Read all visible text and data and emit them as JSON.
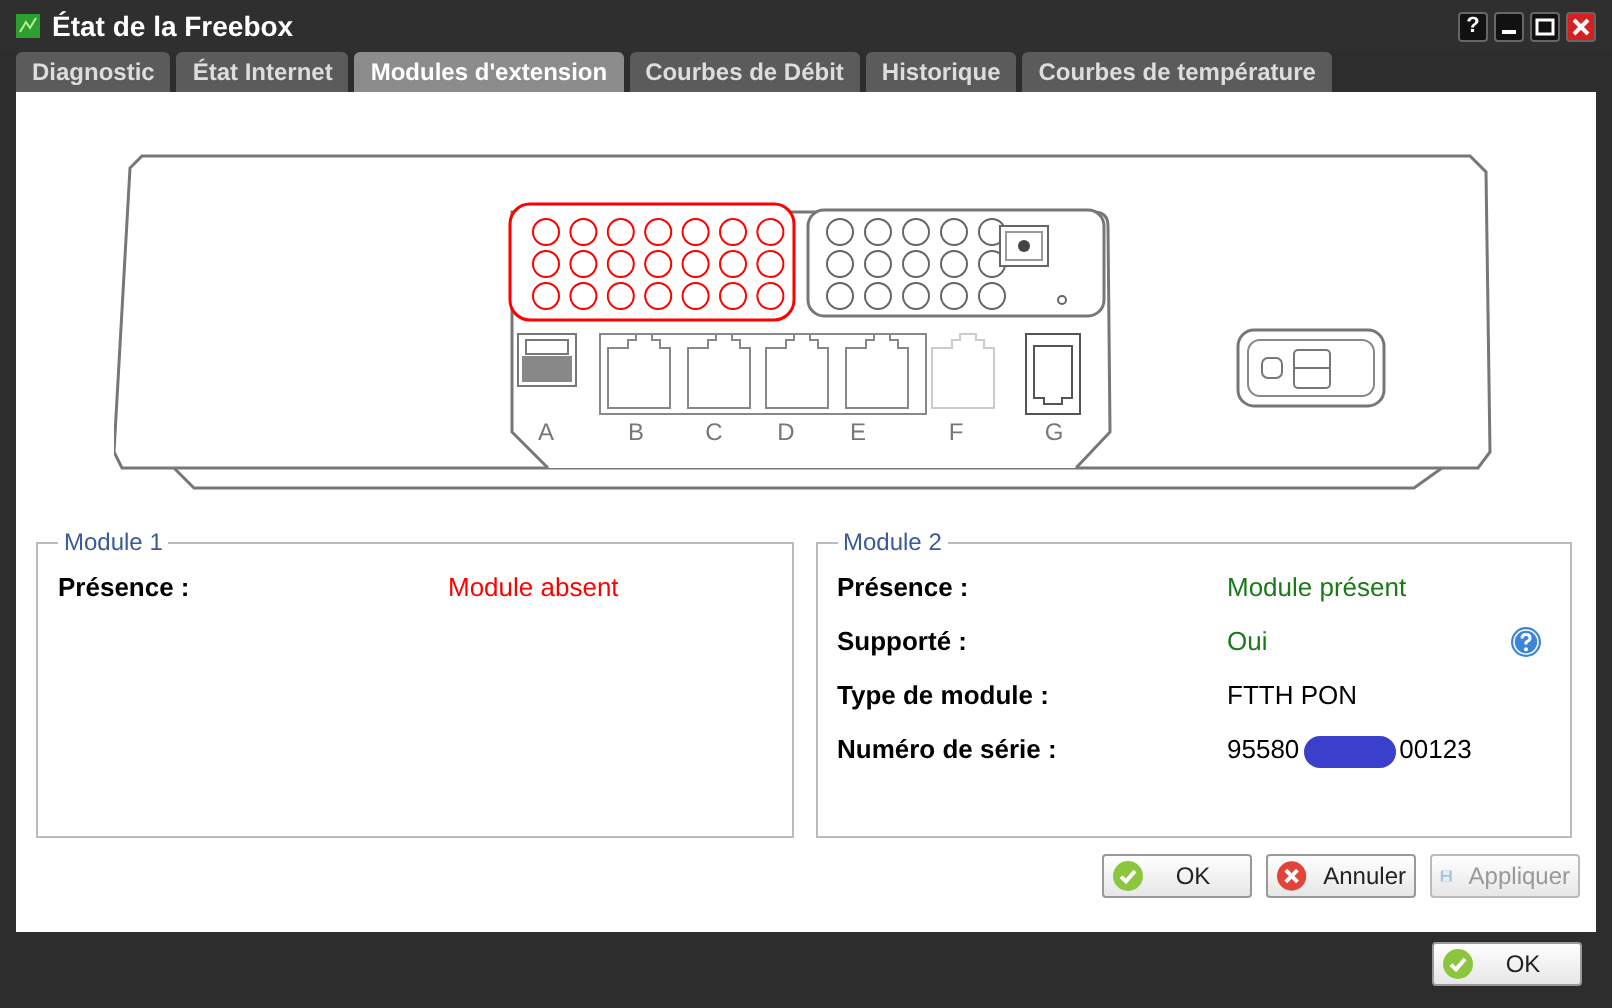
{
  "window": {
    "title": "État de la Freebox",
    "help_button": "?"
  },
  "tabs": [
    {
      "label": "Diagnostic",
      "selected": false
    },
    {
      "label": "État Internet",
      "selected": false
    },
    {
      "label": "Modules d'extension",
      "selected": true
    },
    {
      "label": "Courbes de Débit",
      "selected": false
    },
    {
      "label": "Historique",
      "selected": false
    },
    {
      "label": "Courbes de température",
      "selected": false
    }
  ],
  "device": {
    "ports": [
      {
        "label": "A",
        "kind": "usb"
      },
      {
        "label": "B",
        "kind": "ethernet"
      },
      {
        "label": "C",
        "kind": "ethernet"
      },
      {
        "label": "D",
        "kind": "ethernet"
      },
      {
        "label": "E",
        "kind": "ethernet"
      },
      {
        "label": "F",
        "kind": "ethernet_faint"
      },
      {
        "label": "G",
        "kind": "phone"
      }
    ]
  },
  "modules": [
    {
      "title": "Module 1",
      "highlighted": true,
      "rows": [
        {
          "label": "Présence :",
          "value": [
            "Module absent"
          ],
          "color": "#ff0000",
          "help": false
        }
      ]
    },
    {
      "title": "Module 2",
      "highlighted": false,
      "rows": [
        {
          "label": "Présence :",
          "value": [
            "Module présent"
          ],
          "color": "#1a7a1a",
          "help": false
        },
        {
          "label": "Supporté :",
          "value": [
            "Oui"
          ],
          "color": "#1a7a1a",
          "help": true
        },
        {
          "label": "Type de module :",
          "value": [
            "FTTH PON"
          ],
          "color": "#000000",
          "help": false
        },
        {
          "label": "Numéro de série :",
          "value": [
            "95580",
            "00123"
          ],
          "color": "#000000",
          "help": false
        }
      ]
    }
  ],
  "buttons": [
    {
      "label": "OK",
      "kind": "ok",
      "disabled": false
    },
    {
      "label": "Annuler",
      "kind": "cancel",
      "disabled": false
    },
    {
      "label": "Appliquer",
      "kind": "save",
      "disabled": true
    }
  ],
  "footer_button": {
    "label": "OK",
    "kind": "ok",
    "disabled": false
  }
}
